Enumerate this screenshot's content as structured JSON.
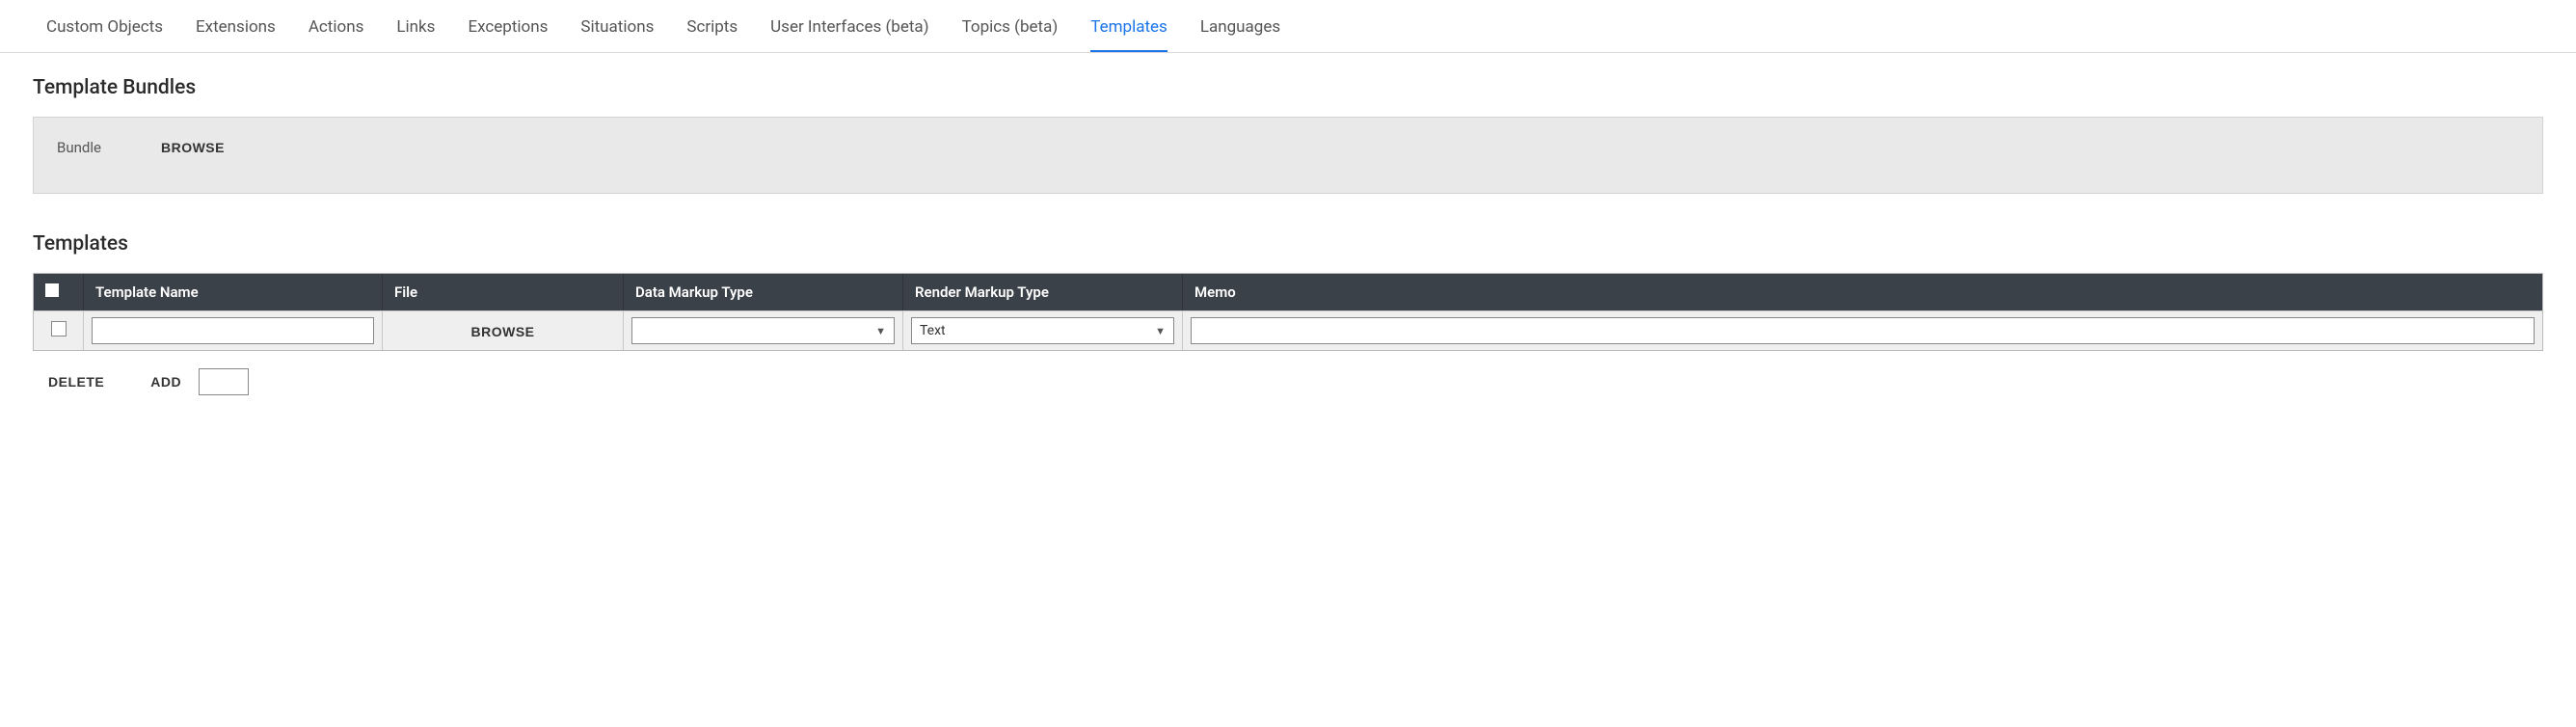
{
  "tabs": [
    {
      "label": "Custom Objects",
      "active": false
    },
    {
      "label": "Extensions",
      "active": false
    },
    {
      "label": "Actions",
      "active": false
    },
    {
      "label": "Links",
      "active": false
    },
    {
      "label": "Exceptions",
      "active": false
    },
    {
      "label": "Situations",
      "active": false
    },
    {
      "label": "Scripts",
      "active": false
    },
    {
      "label": "User Interfaces (beta)",
      "active": false
    },
    {
      "label": "Topics (beta)",
      "active": false
    },
    {
      "label": "Templates",
      "active": true
    },
    {
      "label": "Languages",
      "active": false
    }
  ],
  "sections": {
    "bundles_title": "Template Bundles",
    "templates_title": "Templates"
  },
  "bundle": {
    "label": "Bundle",
    "browse": "BROWSE"
  },
  "table": {
    "headers": {
      "name": "Template Name",
      "file": "File",
      "data_type": "Data Markup Type",
      "render_type": "Render Markup Type",
      "memo": "Memo"
    },
    "row": {
      "name_value": "",
      "file_browse": "BROWSE",
      "data_type_value": "",
      "render_type_value": "Text",
      "memo_value": ""
    }
  },
  "actions": {
    "delete": "DELETE",
    "add": "ADD",
    "add_count": ""
  }
}
